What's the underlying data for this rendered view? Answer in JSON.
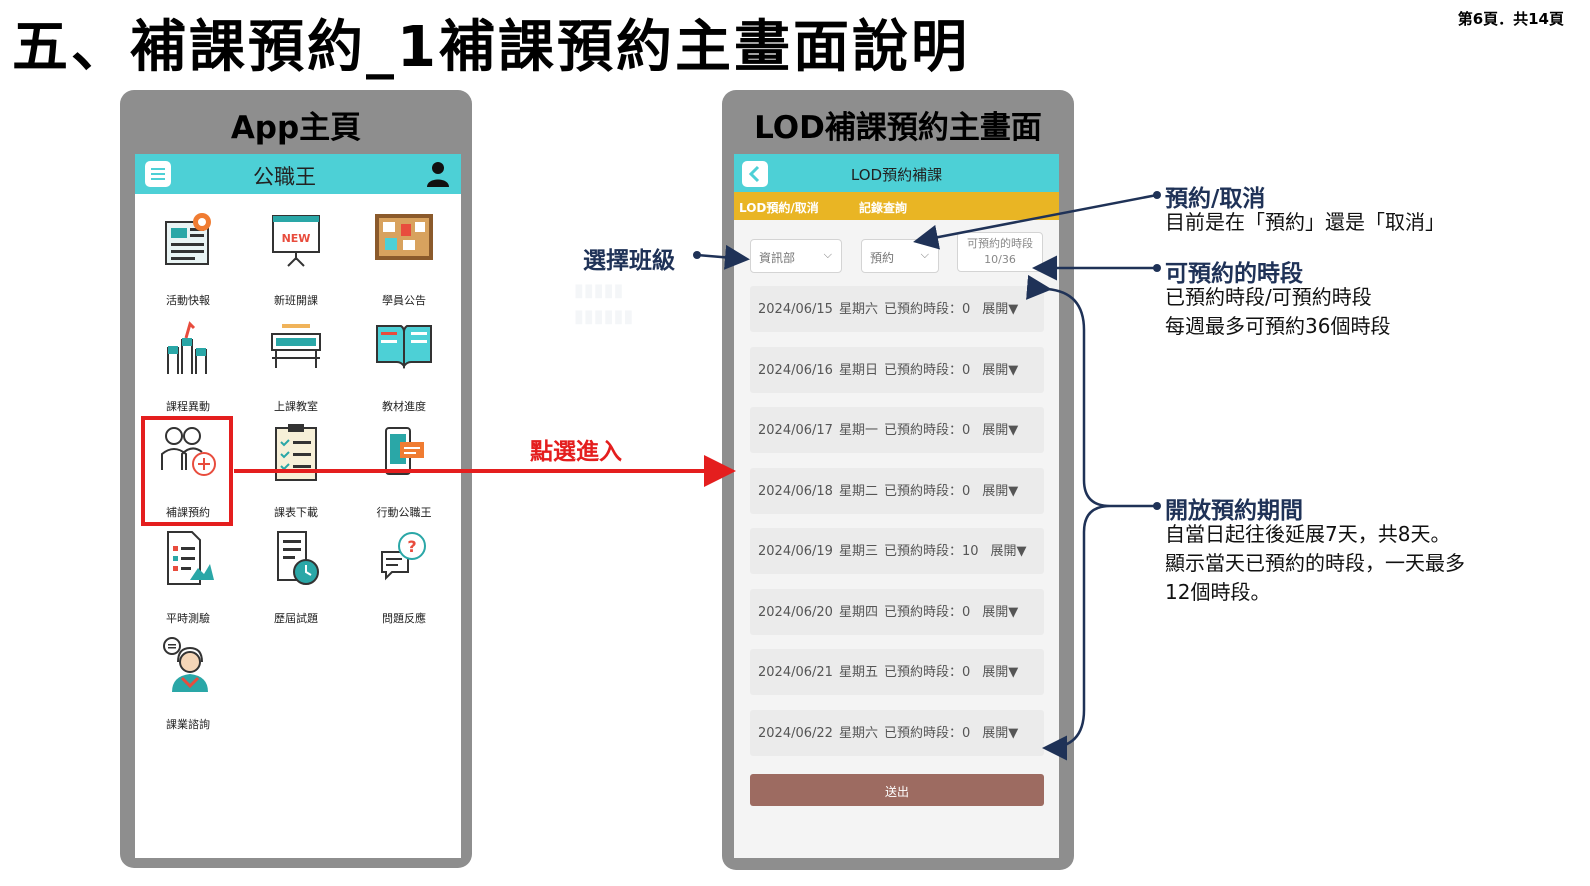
{
  "page": {
    "title": "五、補課預約_1補課預約主畫面說明",
    "page_number": "第6頁．共14頁"
  },
  "app_home": {
    "frame_title": "App主頁",
    "header": {
      "logo_text": "公職王"
    },
    "items": [
      {
        "label": "活動快報",
        "icon": "news-icon"
      },
      {
        "label": "新班開課",
        "icon": "new-board-icon"
      },
      {
        "label": "學員公告",
        "icon": "bulletin-board-icon"
      },
      {
        "label": "課程異動",
        "icon": "hands-raised-icon"
      },
      {
        "label": "上課教室",
        "icon": "classroom-desk-icon"
      },
      {
        "label": "教材進度",
        "icon": "open-book-icon"
      },
      {
        "label": "補課預約",
        "icon": "people-plus-icon"
      },
      {
        "label": "課表下載",
        "icon": "checklist-icon"
      },
      {
        "label": "行動公職王",
        "icon": "mobile-phone-icon"
      },
      {
        "label": "平時測驗",
        "icon": "exam-paper-icon"
      },
      {
        "label": "歷屆試題",
        "icon": "document-clock-icon"
      },
      {
        "label": "問題反應",
        "icon": "question-chat-icon"
      },
      {
        "label": "課業諮詢",
        "icon": "advisor-headset-icon"
      }
    ]
  },
  "arrow_label": "點選進入",
  "lod_screen": {
    "frame_title": "LOD補課預約主畫面",
    "header_title": "LOD預約補課",
    "tabs": [
      "LOD預約/取消",
      "記錄查詢"
    ],
    "class_select": "資訊部",
    "mode_select": "預約",
    "slot_box": {
      "label": "可預約的時段",
      "value": "10/36"
    },
    "dates": [
      {
        "date": "2024/06/15",
        "weekday": "星期六",
        "booked_label": "已預約時段：",
        "booked": "0",
        "expand": "展開▼"
      },
      {
        "date": "2024/06/16",
        "weekday": "星期日",
        "booked_label": "已預約時段：",
        "booked": "0",
        "expand": "展開▼"
      },
      {
        "date": "2024/06/17",
        "weekday": "星期一",
        "booked_label": "已預約時段：",
        "booked": "0",
        "expand": "展開▼"
      },
      {
        "date": "2024/06/18",
        "weekday": "星期二",
        "booked_label": "已預約時段：",
        "booked": "0",
        "expand": "展開▼"
      },
      {
        "date": "2024/06/19",
        "weekday": "星期三",
        "booked_label": "已預約時段：",
        "booked": "10",
        "expand": "展開▼"
      },
      {
        "date": "2024/06/20",
        "weekday": "星期四",
        "booked_label": "已預約時段：",
        "booked": "0",
        "expand": "展開▼"
      },
      {
        "date": "2024/06/21",
        "weekday": "星期五",
        "booked_label": "已預約時段：",
        "booked": "0",
        "expand": "展開▼"
      },
      {
        "date": "2024/06/22",
        "weekday": "星期六",
        "booked_label": "已預約時段：",
        "booked": "0",
        "expand": "展開▼"
      }
    ],
    "submit_label": "送出"
  },
  "annotations": {
    "select_class": "選擇班級",
    "reserve_cancel": {
      "title": "預約/取消",
      "text": "目前是在「預約」還是「取消」"
    },
    "available_slots": {
      "title": "可預約的時段",
      "lines": [
        "已預約時段/可預約時段",
        "每週最多可預約36個時段"
      ]
    },
    "open_period": {
      "title": "開放預約期間",
      "lines": [
        "自當日起往後延展7天，共8天。",
        "顯示當天已預約的時段，一天最多",
        "12個時段。"
      ]
    }
  },
  "colors": {
    "teal_header": "#4dd0d6",
    "tab_yellow": "#e9b524",
    "submit_brown": "#9d6b61",
    "annotation_navy": "#1f3257",
    "highlight_red": "#e41e1e"
  }
}
